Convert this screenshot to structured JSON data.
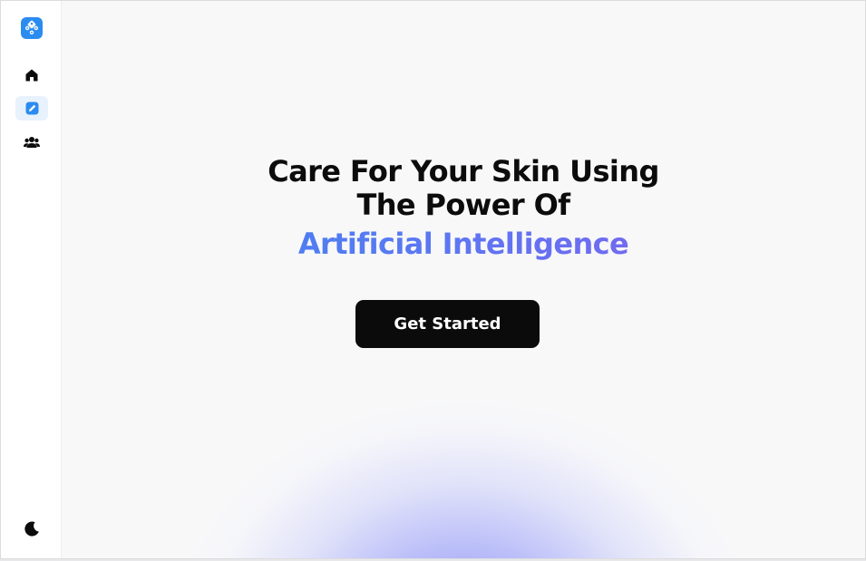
{
  "sidebar": {
    "logo_icon": "dice-logo-icon",
    "items": [
      {
        "icon": "home-icon",
        "active": false
      },
      {
        "icon": "edit-icon",
        "active": true
      },
      {
        "icon": "users-icon",
        "active": false
      }
    ],
    "theme_toggle_icon": "moon-icon"
  },
  "hero": {
    "headline_line1": "Care For Your Skin Using",
    "headline_line2": "The Power Of",
    "highlight": "Artificial Intelligence",
    "cta_label": "Get Started"
  },
  "colors": {
    "accent": "#2b8cf0",
    "active_bg": "#e8f2fd",
    "gradient_start": "#3a86f0",
    "gradient_end": "#8a5cf0",
    "glow": "#8a8cf5",
    "button": "#0b0b0b"
  }
}
